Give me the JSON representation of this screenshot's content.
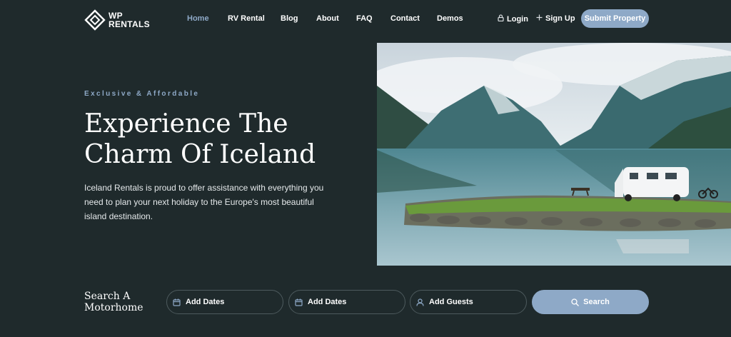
{
  "brand": {
    "line1": "WP",
    "line2": "RENTALS"
  },
  "nav": {
    "items": [
      {
        "label": "Home",
        "active": true
      },
      {
        "label": "RV Rental",
        "active": false
      },
      {
        "label": "Blog",
        "active": false
      },
      {
        "label": "About",
        "active": false
      },
      {
        "label": "FAQ",
        "active": false
      },
      {
        "label": "Contact",
        "active": false
      },
      {
        "label": "Demos",
        "active": false
      }
    ]
  },
  "auth": {
    "login": "Login",
    "signup": "Sign Up",
    "login_icon": "lock-icon",
    "signup_icon": "plus-icon"
  },
  "header": {
    "submit_label": "Submit Property"
  },
  "hero": {
    "eyebrow": "Exclusive & Affordable",
    "title_line1": "Experience The",
    "title_line2": "Charm Of Iceland",
    "lead": "Iceland Rentals is proud to offer assistance with everything you need to plan your next holiday to the Europe's most beautiful island destination.",
    "image_subject": "motorhome parked by a fjord lake with mountains"
  },
  "search": {
    "label_line1": "Search A",
    "label_line2": "Motorhome",
    "checkin_placeholder": "Add Dates",
    "checkout_placeholder": "Add Dates",
    "guests_placeholder": "Add Guests",
    "button_label": "Search",
    "date_icon": "calendar-icon",
    "guests_icon": "user-icon",
    "search_icon": "search-icon"
  },
  "colors": {
    "background": "#1f2a2c",
    "accent": "#8ea9c7",
    "text": "#ffffff",
    "field_border": "#4d5a5d"
  }
}
